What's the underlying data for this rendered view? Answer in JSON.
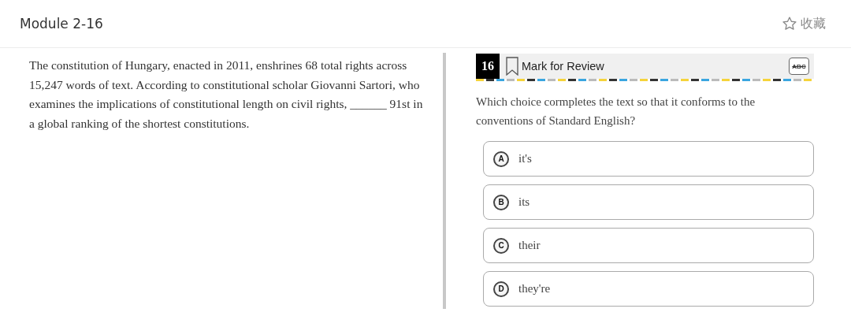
{
  "header": {
    "title": "Module 2-16",
    "favorite": {
      "label": "收藏"
    }
  },
  "passage": "The constitution of Hungary, enacted in 2011, enshrines 68 total rights across 15,247 words of text. According to constitutional scholar Giovanni Sartori, who examines the implications of constitutional length on civil rights, ______ 91st in a global ranking of the shortest constitutions.",
  "question": {
    "number": "16",
    "mark_label": "Mark for Review",
    "eliminator_label": "ABC",
    "prompt": "Which choice cormpletes the text so that it conforms to the conventions of Standard English?",
    "options": [
      {
        "letter": "A",
        "text": "it's"
      },
      {
        "letter": "B",
        "text": "its"
      },
      {
        "letter": "C",
        "text": "their"
      },
      {
        "letter": "D",
        "text": "they're"
      }
    ]
  }
}
